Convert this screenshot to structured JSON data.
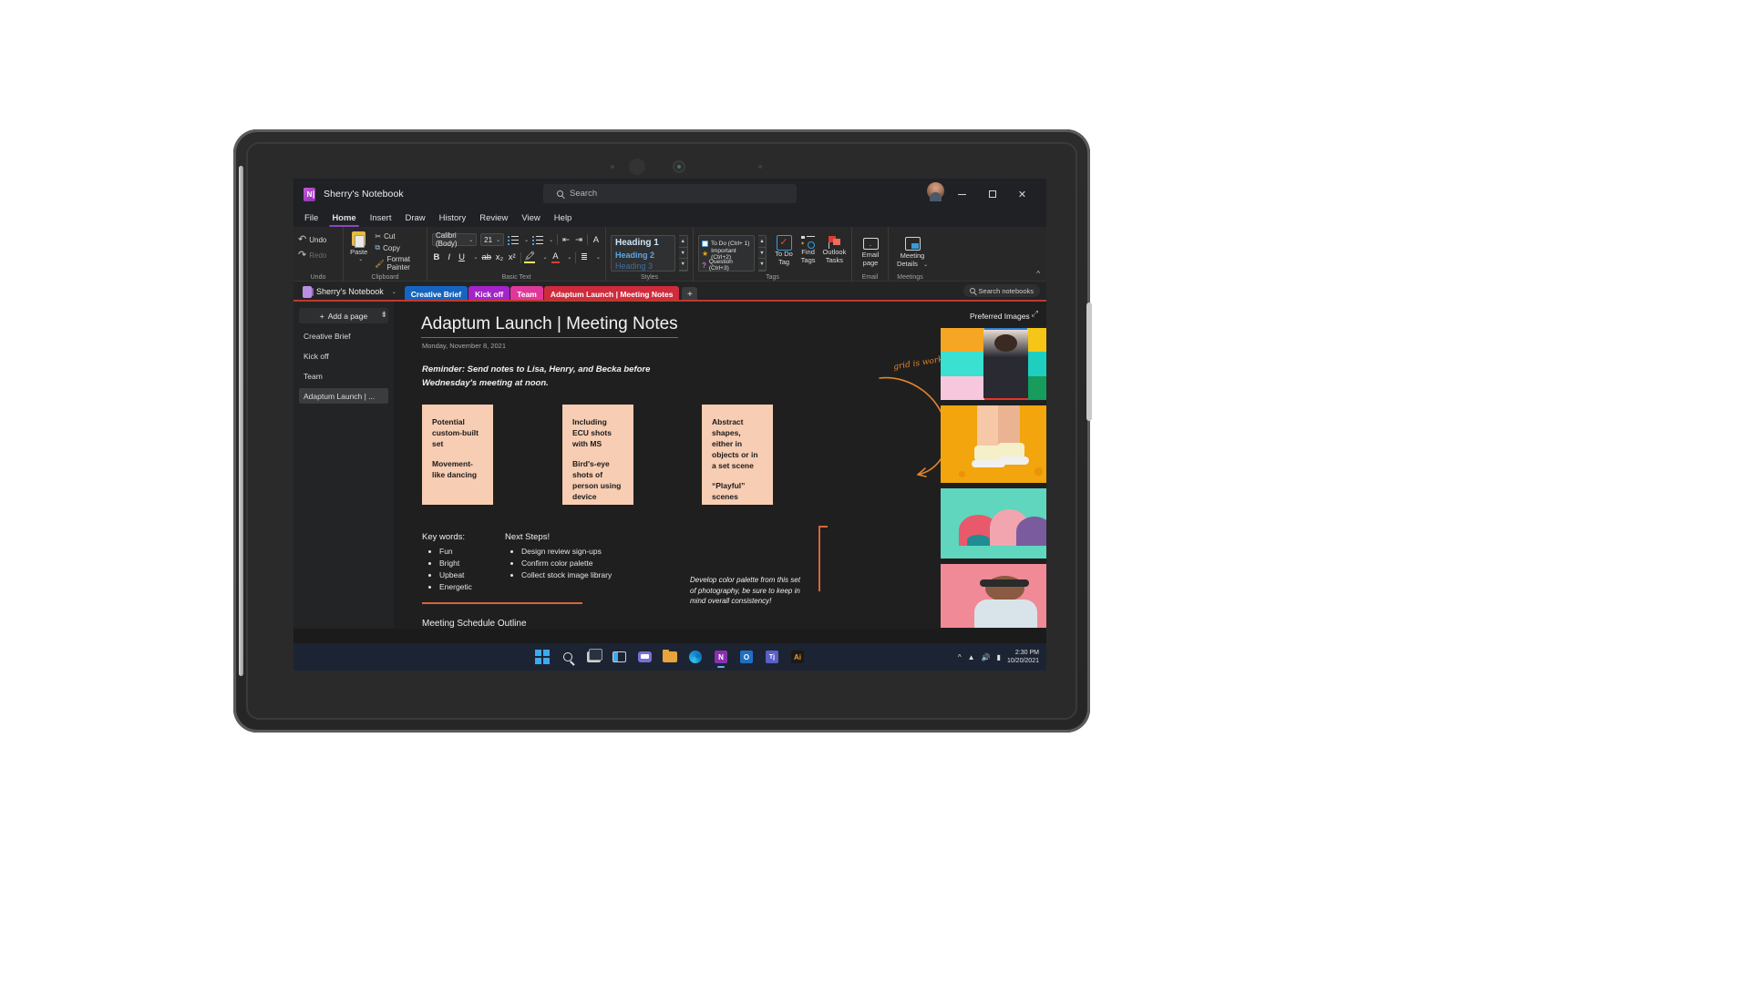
{
  "app": {
    "title": "Sherry's Notebook",
    "search_placeholder": "Search",
    "window_buttons": {
      "minimize": "–",
      "maximize": "▢",
      "close": "✕"
    }
  },
  "menu": {
    "items": [
      "File",
      "Home",
      "Insert",
      "Draw",
      "History",
      "Review",
      "View",
      "Help"
    ],
    "active": "Home"
  },
  "ribbon": {
    "groups": [
      {
        "name": "Undo",
        "label": "Undo",
        "commands": [
          {
            "label": "Undo",
            "icon": "undo-icon",
            "enabled": true
          },
          {
            "label": "Redo",
            "icon": "redo-icon",
            "enabled": false
          }
        ]
      },
      {
        "name": "Clipboard",
        "label": "Clipboard",
        "commands": [
          {
            "label": "Paste",
            "icon": "paste-icon"
          },
          {
            "label": "Cut",
            "icon": "scissors-icon"
          },
          {
            "label": "Copy",
            "icon": "copy-icon"
          },
          {
            "label": "Format Painter",
            "icon": "format-painter-icon"
          }
        ]
      },
      {
        "name": "Basic Text",
        "label": "Basic Text",
        "font_name": "Calibri (Body)",
        "font_size": "21",
        "commands": [
          {
            "label": "Bold",
            "glyph": "B"
          },
          {
            "label": "Italic",
            "glyph": "I"
          },
          {
            "label": "Underline",
            "glyph": "U"
          },
          {
            "label": "Strikethrough",
            "glyph": "ab"
          },
          {
            "label": "Subscript",
            "glyph": "x₂"
          },
          {
            "label": "Superscript",
            "glyph": "x²"
          },
          {
            "label": "Text Highlight Color",
            "icon": "highlighter-icon"
          },
          {
            "label": "Font Color",
            "icon": "font-color-icon"
          },
          {
            "label": "Bullets",
            "icon": "bullets-icon"
          },
          {
            "label": "Numbering",
            "icon": "numbering-icon"
          },
          {
            "label": "Decrease Indent",
            "icon": "decrease-indent-icon"
          },
          {
            "label": "Increase Indent",
            "icon": "increase-indent-icon"
          },
          {
            "label": "Clear Formatting",
            "icon": "clear-formatting-icon"
          },
          {
            "label": "Paragraph Alignment",
            "icon": "align-icon"
          }
        ]
      },
      {
        "name": "Styles",
        "label": "Styles",
        "items": [
          "Heading 1",
          "Heading 2",
          "Heading 3"
        ]
      },
      {
        "name": "Tags",
        "label": "Tags",
        "items": [
          "To Do (Ctrl+ 1)",
          "Important (Ctrl+2)",
          "Question (Ctrl+3)"
        ],
        "buttons": [
          {
            "label": "To Do\nTag",
            "line1": "To Do",
            "line2": "Tag",
            "icon": "checkbox-icon"
          },
          {
            "label": "Find Tags",
            "line1": "Find",
            "line2": "Tags",
            "icon": "find-tags-icon"
          },
          {
            "label": "Outlook Tasks",
            "line1": "Outlook",
            "line2": "Tasks",
            "icon": "flag-icon"
          }
        ]
      },
      {
        "name": "Email",
        "label": "Email",
        "buttons": [
          {
            "line1": "Email",
            "line2": "page",
            "icon": "envelope-icon"
          }
        ]
      },
      {
        "name": "Meetings",
        "label": "Meetings",
        "buttons": [
          {
            "line1": "Meeting",
            "line2": "Details",
            "icon": "calendar-icon"
          }
        ]
      }
    ],
    "collapse_label": "^"
  },
  "tabbar": {
    "notebook_name": "Sherry's Notebook",
    "sections": [
      {
        "label": "Creative Brief",
        "color": "#1565c0",
        "active": false
      },
      {
        "label": "Kick off",
        "color": "#a424c9",
        "active": false
      },
      {
        "label": "Team",
        "color": "#e0389a",
        "active": false
      },
      {
        "label": "Adaptum Launch | Meeting Notes",
        "color": "#cf2b3c",
        "active": true
      }
    ],
    "add_section_label": "+",
    "search_notebooks_label": "Search notebooks"
  },
  "pagelist": {
    "add_page_label": "Add a page",
    "add_page_plus": "+",
    "pages": [
      {
        "label": "Creative Brief",
        "selected": false
      },
      {
        "label": "Kick off",
        "selected": false
      },
      {
        "label": "Team",
        "selected": false
      },
      {
        "label": "Adaptum Launch | ...",
        "selected": true
      }
    ]
  },
  "note": {
    "title": "Adaptum Launch | Meeting Notes",
    "date": "Monday, November 8, 2021",
    "reminder": "Reminder: Send notes to Lisa, Henry, and Becka before Wednesday's meeting at noon.",
    "stickies": [
      {
        "lines": [
          "Potential custom-built set",
          "Movement-like dancing"
        ]
      },
      {
        "lines": [
          "Including ECU shots with MS",
          "Bird's-eye shots of person using device"
        ]
      },
      {
        "lines": [
          "Abstract shapes, either in objects or in a set scene",
          "“Playful” scenes"
        ]
      }
    ],
    "keywords_heading": "Key words:",
    "keywords": [
      "Fun",
      "Bright",
      "Upbeat",
      "Energetic"
    ],
    "next_steps_heading": "Next Steps!",
    "next_steps": [
      "Design review sign-ups",
      "Confirm color palette",
      "Collect stock image library"
    ],
    "schedule_heading": "Meeting Schedule Outline",
    "dev_note": "Develop color palette from this set of photography, be sure to keep in mind overall consistency!",
    "handwriting": "grid is working",
    "preferred_images_heading": "Preferred Images",
    "image_palette": {
      "grid_colors": [
        "#f5a623",
        "#2f7fd4",
        "#f5c518",
        "#3ae0d0",
        "#f0f0f0",
        "#1ecfc0",
        "#f7c8dd",
        "#e8322b",
        "#169c5c"
      ],
      "card2_bg": "#f2a50c",
      "card3_bg": "#5fd6bd",
      "card4_bg": "#f08a96"
    }
  },
  "taskbar": {
    "icons": [
      "start-icon",
      "search-icon",
      "task-view-icon",
      "widgets-icon",
      "chat-icon",
      "file-explorer-icon",
      "edge-icon",
      "onenote-icon",
      "outlook-icon",
      "teams-icon",
      "illustrator-icon"
    ],
    "glyphs": {
      "onenote": "N",
      "outlook": "O",
      "teams": "Tj",
      "illustrator": "Ai"
    },
    "tray": {
      "chevron": "^",
      "wifi": "wifi-icon",
      "volume": "volume-icon",
      "battery": "battery-icon"
    },
    "time": "2:30 PM",
    "date": "10/20/2021"
  }
}
